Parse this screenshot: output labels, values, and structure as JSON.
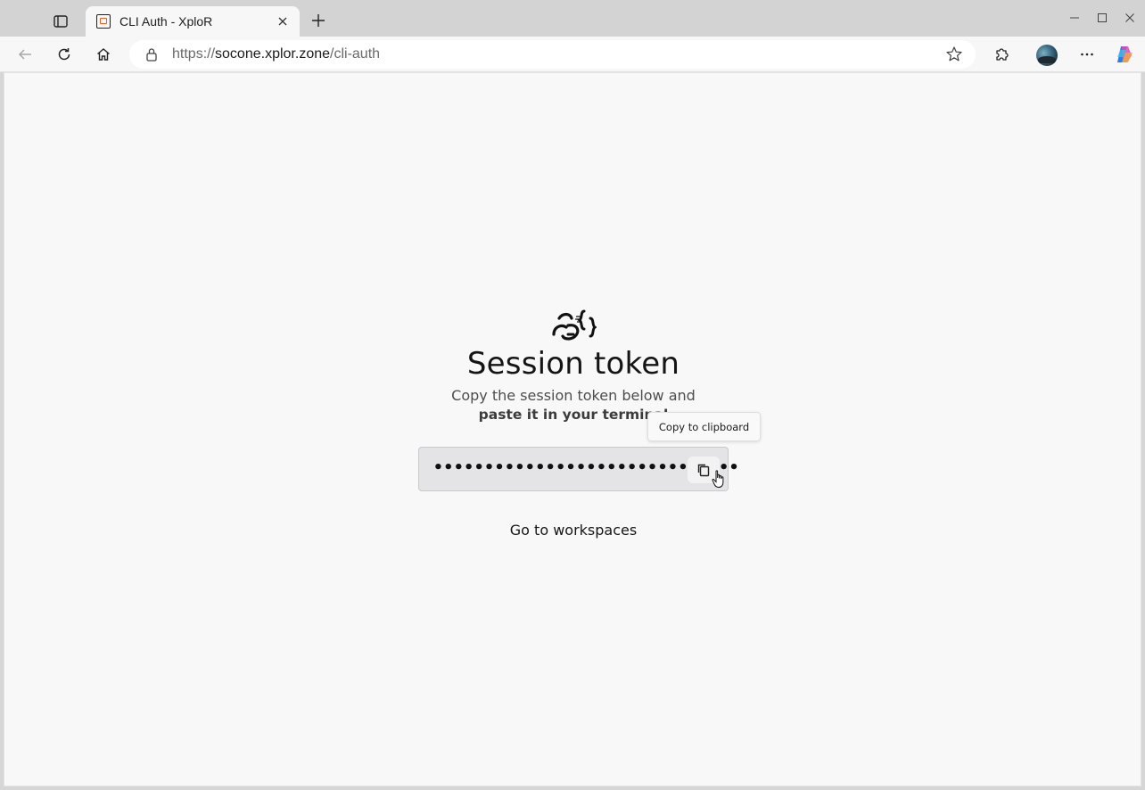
{
  "browser": {
    "tab": {
      "title": "CLI Auth - XploR"
    },
    "address_bar": {
      "url_scheme": "https://",
      "url_host": "socone.xplor.zone",
      "url_path": "/cli-auth"
    },
    "icons": {
      "tab_actions": "tab-actions-icon",
      "close_tab": "close-icon",
      "new_tab": "plus-icon",
      "back": "back-arrow-icon",
      "reload": "reload-icon",
      "home": "home-icon",
      "lock": "lock-icon",
      "favorite": "star-icon",
      "extensions": "puzzle-icon",
      "menu": "more-icon",
      "copilot": "copilot-icon"
    }
  },
  "page": {
    "heading": "Session token",
    "instruction_line1": "Copy the session token below and",
    "instruction_line2": "paste it in your terminal",
    "token_masked": "••••••••••••••••••••••••••••••",
    "tooltip": "Copy to clipboard",
    "go_link": "Go to workspaces"
  }
}
